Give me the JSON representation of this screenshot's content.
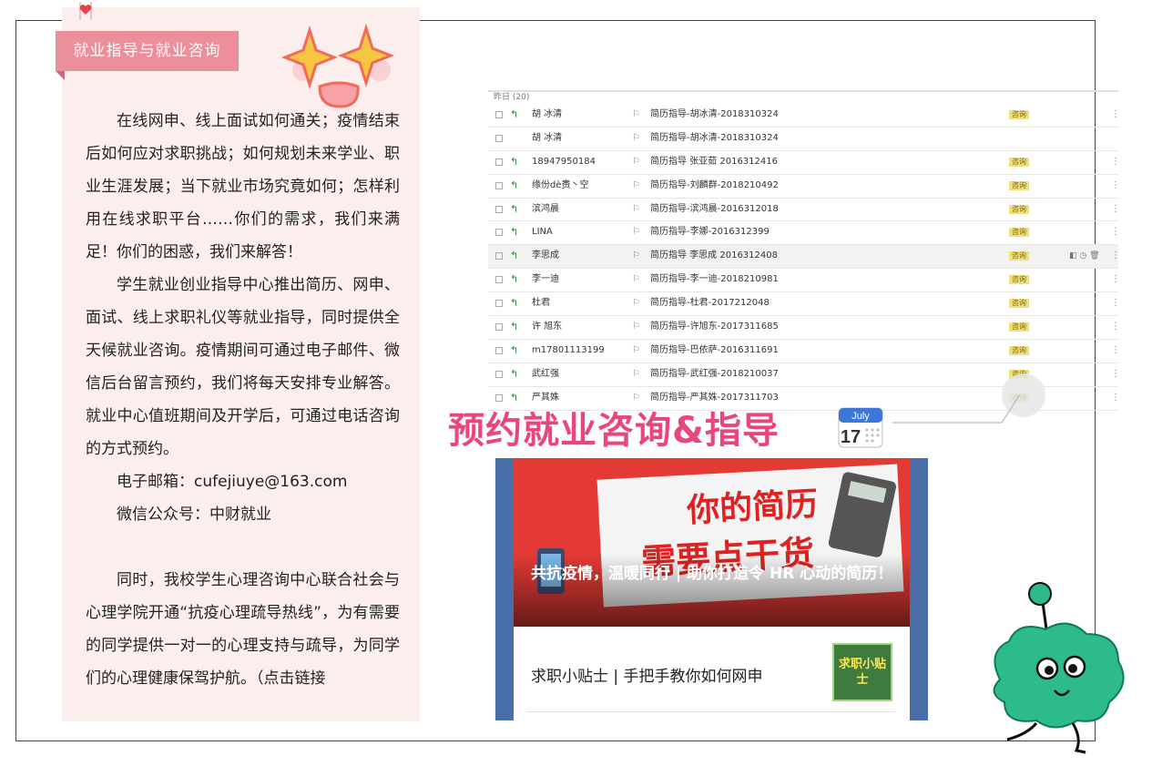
{
  "left": {
    "tag": "就业指导与就业咨询",
    "para1": "在线网申、线上面试如何通关；疫情结束后如何应对求职挑战；如何规划未来学业、职业生涯发展；当下就业市场究竟如何；怎样利用在线求职平台……你们的需求，我们来满足！你们的困惑，我们来解答！",
    "para2": "学生就业创业指导中心推出简历、网申、面试、线上求职礼仪等就业指导，同时提供全天候就业咨询。疫情期间可通过电子邮件、微信后台留言预约，我们将每天安排专业解答。就业中心值班期间及开学后，可通过电话咨询的方式预约。",
    "email": "电子邮箱：cufejiuye@163.com",
    "wechat": "微信公众号：中财就业",
    "para3": "同时，我校学生心理咨询中心联合社会与心理学院开通“抗疫心理疏导热线”，为有需要的同学提供一对一的心理支持与疏导，为同学们的心理健康保驾护航。（点击链接"
  },
  "mail": {
    "group_label": "昨日 (20)",
    "rows": [
      {
        "sender": "胡 冰清",
        "subject": "简历指导-胡冰清-2018310324",
        "tag": "咨询",
        "replied": true
      },
      {
        "sender": "胡 冰清",
        "subject": "简历指导-胡冰清-2018310324",
        "tag": "",
        "replied": false
      },
      {
        "sender": "18947950184",
        "subject": "简历指导 张亚茹 2016312416",
        "tag": "咨询",
        "replied": true
      },
      {
        "sender": "缘份dè赉丶空",
        "subject": "简历指导-刘麟群-2018210492",
        "tag": "咨询",
        "replied": true
      },
      {
        "sender": "滨鸿晨",
        "subject": "简历指导-滨鸿晨-2016312018",
        "tag": "咨询",
        "replied": true
      },
      {
        "sender": "LINA",
        "subject": "简历指导-李娜-2016312399",
        "tag": "咨询",
        "replied": true
      },
      {
        "sender": "李思成",
        "subject": "简历指导 李思成 2016312408",
        "tag": "咨询",
        "replied": true
      },
      {
        "sender": "李一迪",
        "subject": "简历指导-李一迪-2018210981",
        "tag": "咨询",
        "replied": true
      },
      {
        "sender": "杜君",
        "subject": "简历指导-杜君-2017212048",
        "tag": "咨询",
        "replied": true
      },
      {
        "sender": "许 旭东",
        "subject": "简历指导-许旭东-2017311685",
        "tag": "咨询",
        "replied": true
      },
      {
        "sender": "m17801113199",
        "subject": "简历指导-巴依萨-2016311691",
        "tag": "咨询",
        "replied": true
      },
      {
        "sender": "武红强",
        "subject": "简历指导-武红强-2018210037",
        "tag": "咨询",
        "replied": true
      },
      {
        "sender": "严其姝",
        "subject": "简历指导-严其姝-2017311703",
        "tag": "咨询",
        "replied": true
      }
    ]
  },
  "headline": "预约就业咨询&指导",
  "calendar": {
    "month": "July",
    "day": "17"
  },
  "card": {
    "banner_line1": "你的简历",
    "banner_line2": "需要点干货",
    "banner_title": "共抗疫情，温暖同行 | 助你打造令 HR 心动的简历！",
    "tip_title": "求职小贴士 | 手把手教你如何网申",
    "thumb_text": "求职小贴士"
  },
  "colors": {
    "pink_panel": "#fdeeee",
    "tag_pink": "#ec8f9a",
    "headline": "#e8467d",
    "banner_red": "#e33a35",
    "card_blue": "#4a6fa8"
  }
}
